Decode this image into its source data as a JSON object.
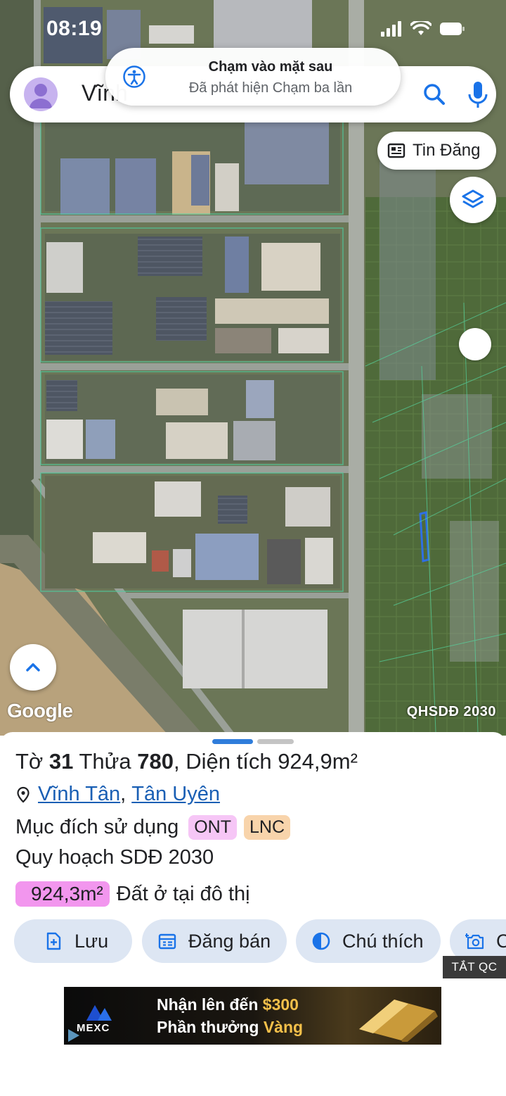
{
  "status_bar": {
    "time": "08:19"
  },
  "search": {
    "query_text": "Vĩnh"
  },
  "toast": {
    "title": "Chạm vào mặt sau",
    "subtitle": "Đã phát hiện Chạm ba lần"
  },
  "map": {
    "news_chip_label": "Tin Đăng",
    "google_logo": "Google",
    "layer_label": "QHSDĐ 2030"
  },
  "parcel": {
    "sheet_label": "Tờ",
    "sheet_no": "31",
    "lot_label": "Thửa",
    "lot_no": "780",
    "area_label": "Diện tích",
    "area_value": "924,9m²",
    "ward": "Vĩnh Tân",
    "separator": ",",
    "district": "Tân Uyên",
    "purpose_label": "Mục đích sử dụng",
    "purpose_tags": [
      "ONT",
      "LNC"
    ],
    "plan_label": "Quy hoạch SDĐ 2030",
    "plan_area_value": "924,3m²",
    "plan_area_desc": "Đất ở tại đô thị"
  },
  "actions": [
    {
      "label": "Lưu",
      "icon": "add-document-icon"
    },
    {
      "label": "Đăng bán",
      "icon": "listing-icon"
    },
    {
      "label": "Chú thích",
      "icon": "contrast-icon"
    },
    {
      "label": "C",
      "icon": "add-photo-icon"
    }
  ],
  "ad": {
    "close_label": "TẮT QC",
    "brand": "MEXC",
    "line1_prefix": "Nhận lên đến ",
    "line1_highlight": "$300",
    "line2_prefix": "Phần thưởng ",
    "line2_highlight": "Vàng"
  },
  "colors": {
    "link": "#1a5fb4",
    "tag_ont": "#f6c6f6",
    "tag_lnc": "#f8d4ab",
    "area_badge": "#f296ee",
    "action_bg": "#dde6f3",
    "handle_active": "#2f7ddb"
  }
}
